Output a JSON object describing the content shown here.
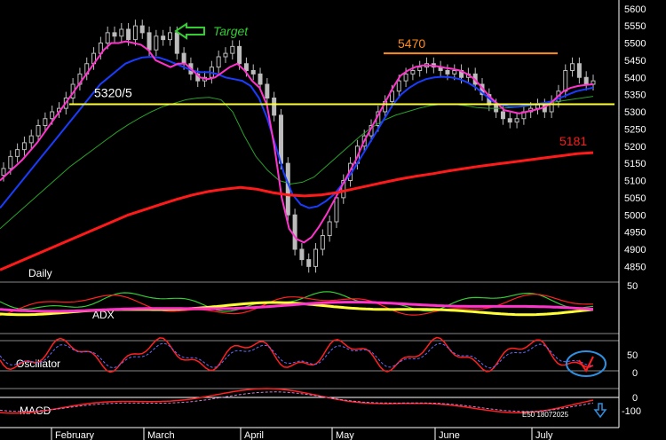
{
  "colors": {
    "background": "#000000",
    "price_bar": "#bcbcbc",
    "ma_short": "#ff33cc",
    "ma_mid": "#1a3cff",
    "ma_long": "#2aa12a",
    "ma_200": "#ff1a1a",
    "support_line": "#ffff33",
    "resistance_line": "#ff8c1a",
    "target_label": "#33cc33",
    "support_fill": "#000000",
    "oscillator": "#ff2020",
    "circle": "#2f8fe0",
    "arrow_up": "#2f8fe0",
    "adx_yellow": "#ffff33",
    "adx_green": "#33cc33"
  },
  "chart_data": {
    "type": "candlestick",
    "panel_labels": {
      "daily": "Daily",
      "adx": "ADX",
      "oscillator": "Oscillator",
      "macd": "MACD"
    },
    "x_ticks": [
      "February",
      "March",
      "April",
      "May",
      "June",
      "July"
    ],
    "y_ticks": [
      5600,
      5550,
      5500,
      5450,
      5400,
      5350,
      5300,
      5250,
      5200,
      5150,
      5100,
      5050,
      5000,
      4950,
      4900,
      4850
    ],
    "ylim": [
      4820,
      5620
    ],
    "adx_axis": [
      "50"
    ],
    "oscillator_axis": [
      "50",
      "0"
    ],
    "macd_axis": [
      "0",
      "-100"
    ],
    "annotations": {
      "support_label": "5320/5",
      "support_level": 5322,
      "resistance_label": "5470",
      "resistance_level": 5470,
      "ma200_label": "5181",
      "ma200_level": 5181,
      "target_label": "Target",
      "watermark": "E50 18072025"
    },
    "series": [
      {
        "name": "close",
        "values": [
          5135,
          5170,
          5190,
          5210,
          5230,
          5260,
          5280,
          5300,
          5310,
          5340,
          5380,
          5410,
          5440,
          5470,
          5500,
          5530,
          5520,
          5540,
          5510,
          5550,
          5530,
          5480,
          5520,
          5510,
          5530,
          5470,
          5440,
          5410,
          5390,
          5400,
          5430,
          5460,
          5470,
          5490,
          5440,
          5420,
          5410,
          5380,
          5340,
          5290,
          5150,
          5000,
          4900,
          4870,
          4850,
          4900,
          4940,
          4980,
          5050,
          5100,
          5150,
          5200,
          5230,
          5260,
          5300,
          5330,
          5360,
          5390,
          5410,
          5420,
          5430,
          5440,
          5430,
          5420,
          5410,
          5420,
          5400,
          5410,
          5380,
          5350,
          5320,
          5300,
          5280,
          5270,
          5280,
          5300,
          5310,
          5320,
          5300,
          5330,
          5360,
          5420,
          5440,
          5400,
          5380,
          5390
        ]
      },
      {
        "name": "ma_short",
        "values": [
          5100,
          5120,
          5140,
          5160,
          5185,
          5210,
          5240,
          5270,
          5300,
          5330,
          5360,
          5390,
          5420,
          5450,
          5480,
          5500,
          5500,
          5505,
          5500,
          5495,
          5480,
          5450,
          5440,
          5430,
          5440,
          5440,
          5420,
          5400,
          5395,
          5400,
          5415,
          5430,
          5440,
          5420,
          5390,
          5370,
          5320,
          5200,
          5050,
          4960,
          4930,
          4920,
          4935,
          4965,
          5000,
          5040,
          5080,
          5120,
          5160,
          5210,
          5250,
          5290,
          5330,
          5370,
          5405,
          5420,
          5430,
          5435,
          5435,
          5432,
          5428,
          5425,
          5420,
          5410,
          5395,
          5370,
          5345,
          5325,
          5305,
          5300,
          5295,
          5300,
          5305,
          5310,
          5320,
          5340,
          5360,
          5370,
          5375,
          5378,
          5380
        ]
      },
      {
        "name": "ma_mid",
        "values": [
          5020,
          5050,
          5080,
          5110,
          5140,
          5170,
          5200,
          5230,
          5260,
          5290,
          5320,
          5350,
          5380,
          5400,
          5420,
          5440,
          5450,
          5458,
          5460,
          5458,
          5450,
          5440,
          5430,
          5420,
          5415,
          5415,
          5410,
          5400,
          5395,
          5390,
          5375,
          5340,
          5280,
          5200,
          5120,
          5060,
          5030,
          5020,
          5025,
          5040,
          5060,
          5090,
          5120,
          5160,
          5200,
          5240,
          5280,
          5320,
          5350,
          5370,
          5385,
          5395,
          5400,
          5402,
          5400,
          5395,
          5385,
          5370,
          5350,
          5330,
          5320,
          5315,
          5315,
          5318,
          5322,
          5325,
          5330,
          5340,
          5350,
          5360,
          5365,
          5370
        ]
      },
      {
        "name": "ma_long",
        "values": [
          4960,
          4990,
          5020,
          5050,
          5080,
          5110,
          5140,
          5165,
          5190,
          5215,
          5240,
          5262,
          5282,
          5300,
          5315,
          5325,
          5335,
          5340,
          5342,
          5335,
          5300,
          5230,
          5170,
          5130,
          5100,
          5090,
          5095,
          5110,
          5140,
          5170,
          5200,
          5230,
          5255,
          5275,
          5290,
          5300,
          5310,
          5318,
          5322,
          5322,
          5318,
          5312,
          5310,
          5310,
          5312,
          5315,
          5320,
          5325,
          5330,
          5335,
          5340,
          5345
        ]
      },
      {
        "name": "ma_200",
        "values": [
          4840,
          4860,
          4880,
          4900,
          4920,
          4940,
          4960,
          4980,
          5000,
          5015,
          5030,
          5045,
          5058,
          5068,
          5075,
          5080,
          5075,
          5065,
          5058,
          5055,
          5058,
          5065,
          5075,
          5085,
          5095,
          5105,
          5113,
          5120,
          5128,
          5135,
          5142,
          5148,
          5154,
          5160,
          5166,
          5172,
          5178,
          5181
        ]
      }
    ]
  }
}
